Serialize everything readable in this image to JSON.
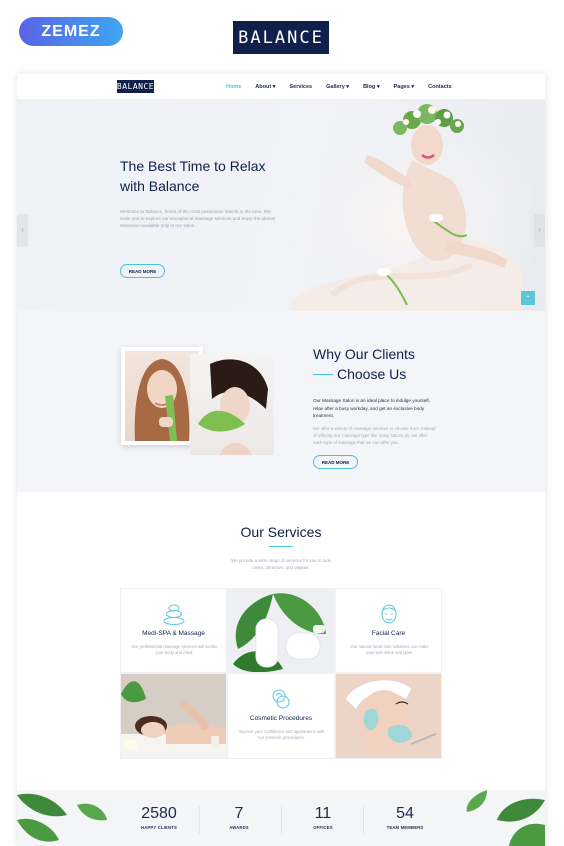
{
  "showcase": {
    "badge_label": "ZEMEZ",
    "logo_text": "BALANCE"
  },
  "nav": {
    "logo_text": "BALANCE",
    "items": [
      {
        "label": "Home"
      },
      {
        "label": "About"
      },
      {
        "label": "Services"
      },
      {
        "label": "Gallery"
      },
      {
        "label": "Blog"
      },
      {
        "label": "Pages"
      },
      {
        "label": "Contacts"
      }
    ],
    "dropdown_mark": "▾"
  },
  "hero": {
    "title_line1": "The Best Time to Relax",
    "title_line2": "with Balance",
    "text": "Welcome to Balance, home of the most passionate talents in the area. We invite you to explore our exceptional massage services and enjoy the utmost relaxation available only at our salon.",
    "button_label": "READ MORE",
    "arrow_left": "‹",
    "arrow_right": "›",
    "scroll_top": "⌃"
  },
  "why": {
    "title_line1": "Why Our Clients",
    "title_line2": "Choose Us",
    "lead": "Our Massage Salon is an ideal place to indulge yourself, relax after a busy workday, and get an exclusive body treatment.",
    "text": "We offer a variety of massage services to choose from. Instead of offering one massage type like many salons do, we offer each type of massage that we can offer you.",
    "button_label": "READ MORE"
  },
  "services": {
    "title": "Our Services",
    "subtitle": "We provide a wide range of services for you to look clean, attractive, and original.",
    "items": [
      {
        "name": "Medi-SPA & Massage",
        "desc": "Our professional massage services will soothe your body and mind.",
        "icon": "stones-icon"
      },
      {
        "name": "Facial Care",
        "desc": "Our natural facial care solutions can make your skin shine and glow.",
        "icon": "face-icon"
      },
      {
        "name": "Cosmetic Procedures",
        "desc": "Improve your confidence and appearance with our cosmetic procedures.",
        "icon": "cosmetic-icon"
      }
    ]
  },
  "stats": [
    {
      "value": "2580",
      "label": "HAPPY CLIENTS"
    },
    {
      "value": "7",
      "label": "AWARDS"
    },
    {
      "value": "11",
      "label": "OFFICES"
    },
    {
      "value": "54",
      "label": "TEAM MEMBERS"
    }
  ],
  "colors": {
    "navy": "#10204a",
    "accent": "#46c3d6",
    "badge_start": "#5a63e6",
    "badge_end": "#3ea6f0"
  }
}
